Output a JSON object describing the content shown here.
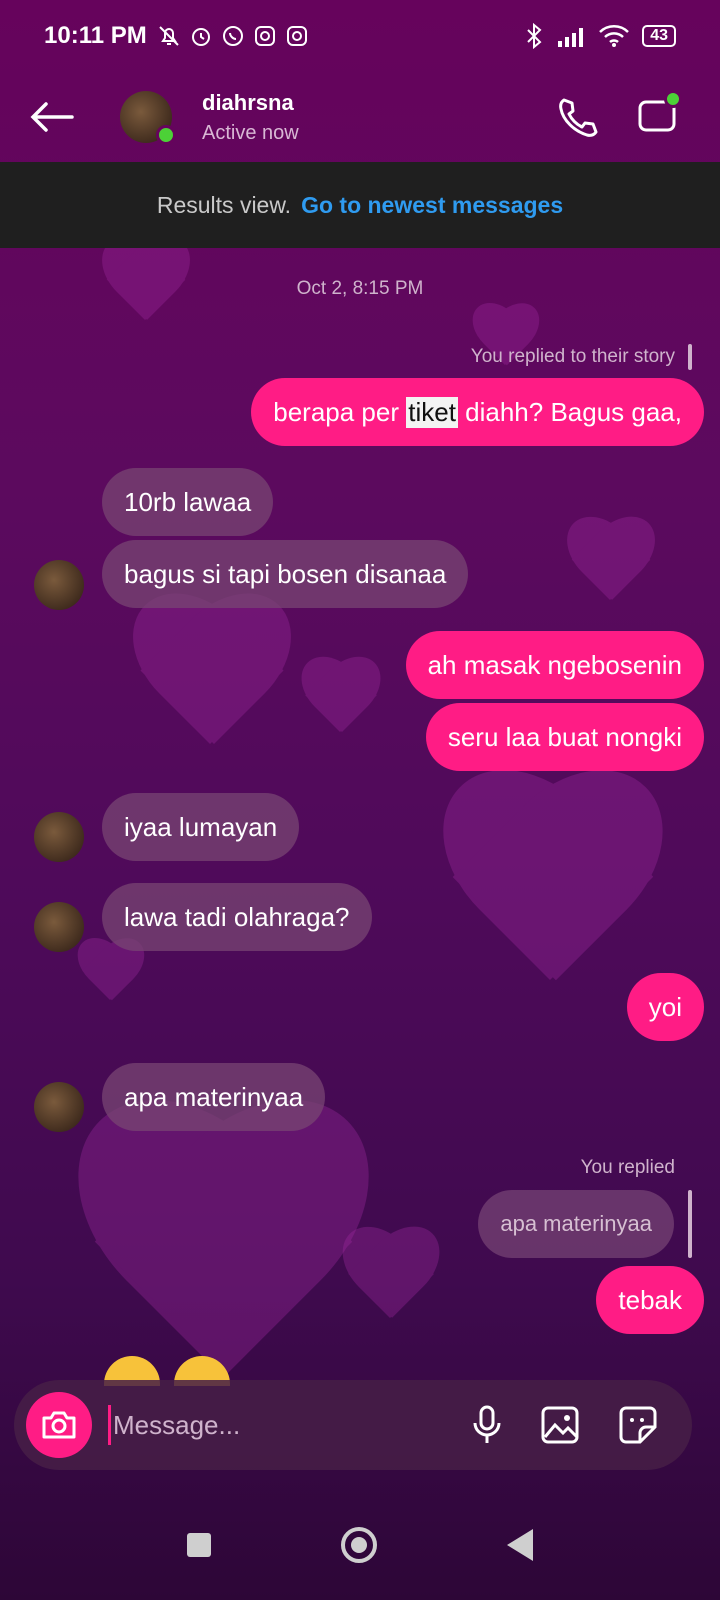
{
  "status_bar": {
    "time": "10:11 PM",
    "battery": "43"
  },
  "header": {
    "name": "diahrsna",
    "status": "Active now"
  },
  "banner": {
    "text": "Results view.",
    "link": "Go to newest messages"
  },
  "chat": {
    "timestamp": "Oct 2, 8:15 PM",
    "story_reply_label": "You replied to their story",
    "msg1_before": "berapa per ",
    "msg1_highlight": "tiket",
    "msg1_after": " diahh? Bagus gaa,",
    "msg2": "10rb lawaa",
    "msg3": "bagus si tapi bosen disanaa",
    "msg4": "ah masak ngebosenin",
    "msg5": "seru laa buat nongki",
    "msg6": "iyaa lumayan",
    "msg7": "lawa tadi olahraga?",
    "msg8": "yoi",
    "msg9": "apa materinyaa",
    "reply_label": "You replied",
    "quoted": "apa materinyaa",
    "msg10": "tebak"
  },
  "composer": {
    "placeholder": "Message..."
  }
}
